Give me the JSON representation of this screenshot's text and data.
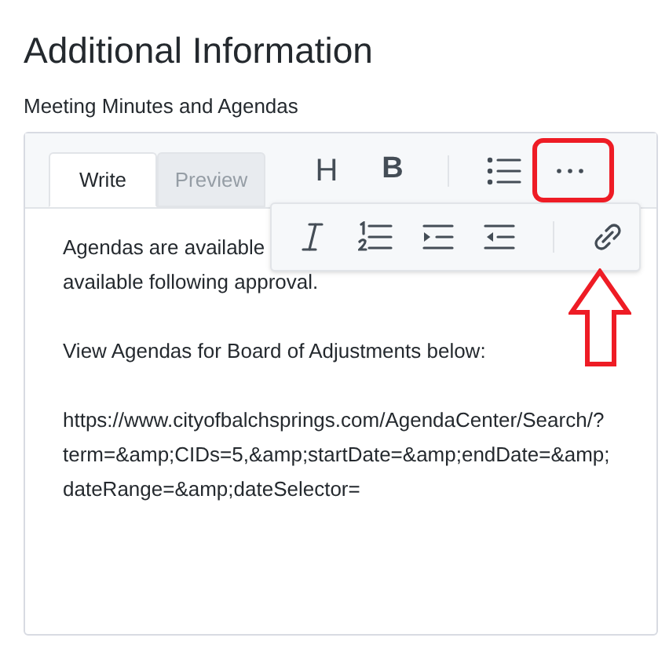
{
  "title": "Additional Information",
  "field_label": "Meeting Minutes and Agendas",
  "tabs": [
    {
      "label": "Write",
      "selected": true
    },
    {
      "label": "Preview",
      "selected": false
    }
  ],
  "toolbar": [
    {
      "kind": "heading",
      "label": "H"
    },
    {
      "kind": "bold",
      "label": "B"
    },
    {
      "kind": "divider"
    },
    {
      "kind": "bullet-list"
    },
    {
      "kind": "more"
    }
  ],
  "more_menu": [
    {
      "kind": "italic"
    },
    {
      "kind": "numbered-list"
    },
    {
      "kind": "indent"
    },
    {
      "kind": "outdent"
    },
    {
      "kind": "divider"
    },
    {
      "kind": "link"
    }
  ],
  "paragraphs": [
    [
      "Agendas are available",
      "available following approval."
    ],
    [
      "View Agendas for Board of Adjustments below:"
    ],
    [
      "https://www.cityofbalchsprings.com/AgendaCenter/Search/?",
      "term=&amp;CIDs=5,&amp;startDate=&amp;endDate=&amp;",
      "dateRange=&amp;dateSelector="
    ]
  ]
}
